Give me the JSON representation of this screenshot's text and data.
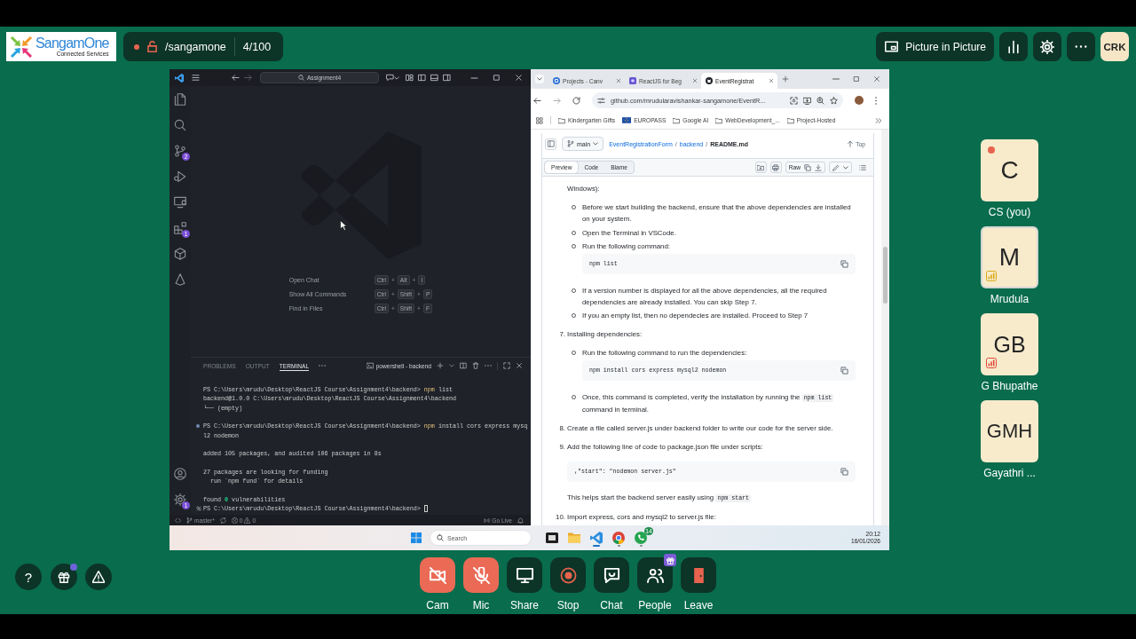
{
  "top_bar": {
    "logo": {
      "name": "SangamOne",
      "tagline": "Connected Services"
    },
    "room": {
      "recording": true,
      "locked": false,
      "name": "/sangamone",
      "participants": "4/100"
    },
    "actions": [
      {
        "kind": "pip",
        "label": "Picture in Picture"
      },
      {
        "kind": "stats"
      },
      {
        "kind": "settings"
      },
      {
        "kind": "more"
      }
    ],
    "avatar": "CRK"
  },
  "shared_screen": {
    "vscode": {
      "command_center": "Assignment4",
      "activity_bar": [
        {
          "kind": "explorer"
        },
        {
          "kind": "search"
        },
        {
          "kind": "source-control",
          "badge": "2"
        },
        {
          "kind": "run-debug"
        },
        {
          "kind": "remote"
        },
        {
          "kind": "extensions",
          "badge": "1"
        },
        {
          "kind": "package"
        },
        {
          "kind": "triangle"
        }
      ],
      "activity_bottom": [
        {
          "kind": "accounts"
        },
        {
          "kind": "manage",
          "badge": "1"
        }
      ],
      "shortcuts": [
        {
          "label": "Open Chat",
          "keys": [
            "Ctrl",
            "+",
            "Alt",
            "+",
            "I"
          ]
        },
        {
          "label": "Show All Commands",
          "keys": [
            "Ctrl",
            "+",
            "Shift",
            "+",
            "P"
          ]
        },
        {
          "label": "Find in Files",
          "keys": [
            "Ctrl",
            "+",
            "Shift",
            "+",
            "F"
          ]
        }
      ],
      "panel_tabs": [
        {
          "label": "PROBLEMS",
          "selected": false
        },
        {
          "label": "OUTPUT",
          "selected": false
        },
        {
          "label": "TERMINAL",
          "selected": true
        }
      ],
      "terminal_name": "powershell - backend",
      "terminal": [
        {
          "kind": "command",
          "dot": false,
          "marker": false,
          "prompt": "PS C:\\Users\\mrudu\\Desktop\\ReactJS Course\\Assignment4\\backend>",
          "program": "npm",
          "args": "list",
          "cursor": false
        },
        {
          "kind": "output",
          "text": "backend@1.0.0 C:\\Users\\mrudu\\Desktop\\ReactJS Course\\Assignment4\\backend"
        },
        {
          "kind": "output",
          "text": "└── (empty)"
        },
        {
          "kind": "blank"
        },
        {
          "kind": "command",
          "dot": true,
          "marker": false,
          "prompt": "PS C:\\Users\\mrudu\\Desktop\\ReactJS Course\\Assignment4\\backend>",
          "program": "npm",
          "args": "install cors express mysq",
          "cursor": false
        },
        {
          "kind": "output",
          "text": "l2 nodemon"
        },
        {
          "kind": "blank"
        },
        {
          "kind": "output",
          "text": "added 105 packages, and audited 106 packages in 8s"
        },
        {
          "kind": "blank"
        },
        {
          "kind": "output",
          "text": "27 packages are looking for funding"
        },
        {
          "kind": "output",
          "text": "  run `npm fund` for details"
        },
        {
          "kind": "blank"
        },
        {
          "kind": "output",
          "text": "found **0** vulnerabilities"
        },
        {
          "kind": "command",
          "dot": false,
          "marker": true,
          "prompt": "PS C:\\Users\\mrudu\\Desktop\\ReactJS Course\\Assignment4\\backend>",
          "cursor": true
        }
      ],
      "status_bar": {
        "branch": "master*",
        "errors": "0",
        "warnings": "0",
        "live": "Go Live"
      }
    },
    "browser": {
      "tabs": [
        {
          "kind": "canvas",
          "title": "Projects - Canv",
          "selected": false
        },
        {
          "kind": "course",
          "title": "ReactJS for Beg",
          "selected": false
        },
        {
          "kind": "github",
          "title": "EventRegistrat",
          "selected": true
        }
      ],
      "url": "github.com/mrudularavishankar-sangamone/EventR...",
      "bookmarks": [
        {
          "kind": "folder",
          "label": "Kindergarten Gifts"
        },
        {
          "kind": "flag",
          "label": "EUROPASS"
        },
        {
          "kind": "folder",
          "label": "Google AI"
        },
        {
          "kind": "folder",
          "label": "WebDevelopment_..."
        },
        {
          "kind": "folder",
          "label": "Project-Hosted"
        }
      ],
      "branch": "main",
      "breadcrumb": [
        "EventRegistrationForm",
        "/",
        "backend",
        "/",
        "README.md"
      ],
      "top_link": "Top",
      "view_tabs": [
        {
          "label": "Preview",
          "selected": true
        },
        {
          "label": "Code",
          "selected": false
        },
        {
          "label": "Blame",
          "selected": false
        }
      ],
      "raw": "Raw",
      "readme": [
        {
          "kind": "continuation",
          "text": "Windows):",
          "children": [
            {
              "kind": "bullet",
              "text": "Before we start building the backend, ensure that the above dependencies are installed on your system."
            },
            {
              "kind": "bullet",
              "text": "Open the Terminal in VSCode."
            },
            {
              "kind": "bullet",
              "text": "Run the following command:",
              "children": [
                {
                  "kind": "code",
                  "text": "npm list"
                }
              ]
            },
            {
              "kind": "bullet",
              "text": "If a version number is displayed for all the above dependencies, all the required dependencies are already installed. You can skip Step 7."
            },
            {
              "kind": "bullet",
              "text": "If you an empty list, then no dependecies are installed. Proceed to Step 7"
            }
          ]
        },
        {
          "kind": "step",
          "number": "7.",
          "text": "Installing dependencies:",
          "children": [
            {
              "kind": "bullet",
              "text": "Run the following command to run the dependencies:",
              "children": [
                {
                  "kind": "code",
                  "text": "npm install cors express mysql2 nodemon"
                }
              ]
            },
            {
              "kind": "bullet",
              "parts": [
                {
                  "kind": "text",
                  "text": "Once, this command is completed, verify the installation by running the "
                },
                {
                  "kind": "code",
                  "text": "npm list"
                },
                {
                  "kind": "text",
                  "text": " command in terminal."
                }
              ]
            }
          ]
        },
        {
          "kind": "step",
          "number": "8.",
          "text": "Create a file called server.js under backend folder to write our code for the server side."
        },
        {
          "kind": "step",
          "number": "9.",
          "text": "Add the following line of code to package.json file under scripts:",
          "children": [
            {
              "kind": "code",
              "text": ",\"start\": \"nodemon server.js\""
            },
            {
              "kind": "paragraph",
              "parts": [
                {
                  "kind": "text",
                  "text": "This helps start the backend server easily using "
                },
                {
                  "kind": "code",
                  "text": "npm start"
                }
              ]
            }
          ]
        },
        {
          "kind": "step",
          "number": "10.",
          "text": "Import express, cors and mysql2 to server.js file:"
        }
      ]
    },
    "taskbar": {
      "search": {
        "placeholder": "Search"
      },
      "apps": [
        {
          "kind": "task-view",
          "active": false,
          "running": false
        },
        {
          "kind": "file-explorer",
          "active": false,
          "running": false
        },
        {
          "kind": "vscode",
          "active": true,
          "running": true
        },
        {
          "kind": "chrome",
          "active": false,
          "running": true
        },
        {
          "kind": "whatsapp",
          "active": false,
          "running": true,
          "badge": "14"
        }
      ],
      "time": "20:12",
      "date": "16/01/2026"
    }
  },
  "participants": [
    {
      "initials": "C",
      "name": "CS (you)",
      "speaking": false,
      "status_dot": true,
      "signal": false
    },
    {
      "initials": "M",
      "name": "Mrudula",
      "speaking": true,
      "status_dot": false,
      "signal": true,
      "color": "#d8a915"
    },
    {
      "initials": "GB",
      "name": "G Bhupathe",
      "speaking": false,
      "status_dot": false,
      "signal": true,
      "color": "#e04a3a"
    },
    {
      "initials": "GMH",
      "name": "Gayathri ...",
      "speaking": false,
      "status_dot": false,
      "signal": false
    }
  ],
  "bottom_bar": {
    "left": [
      {
        "kind": "help",
        "glyph": "?"
      },
      {
        "kind": "gift",
        "badge": true
      },
      {
        "kind": "report"
      }
    ],
    "controls": [
      {
        "kind": "cam",
        "label": "Cam",
        "off": true,
        "badge": false
      },
      {
        "kind": "mic",
        "label": "Mic",
        "off": true,
        "badge": false
      },
      {
        "kind": "share",
        "label": "Share",
        "off": false,
        "badge": false
      },
      {
        "kind": "record",
        "label": "Stop",
        "off": false,
        "badge": false
      },
      {
        "kind": "chat",
        "label": "Chat",
        "off": false,
        "badge": false
      },
      {
        "kind": "people",
        "label": "People",
        "off": false,
        "badge": true
      },
      {
        "kind": "leave",
        "label": "Leave",
        "off": false,
        "badge": false
      }
    ]
  }
}
